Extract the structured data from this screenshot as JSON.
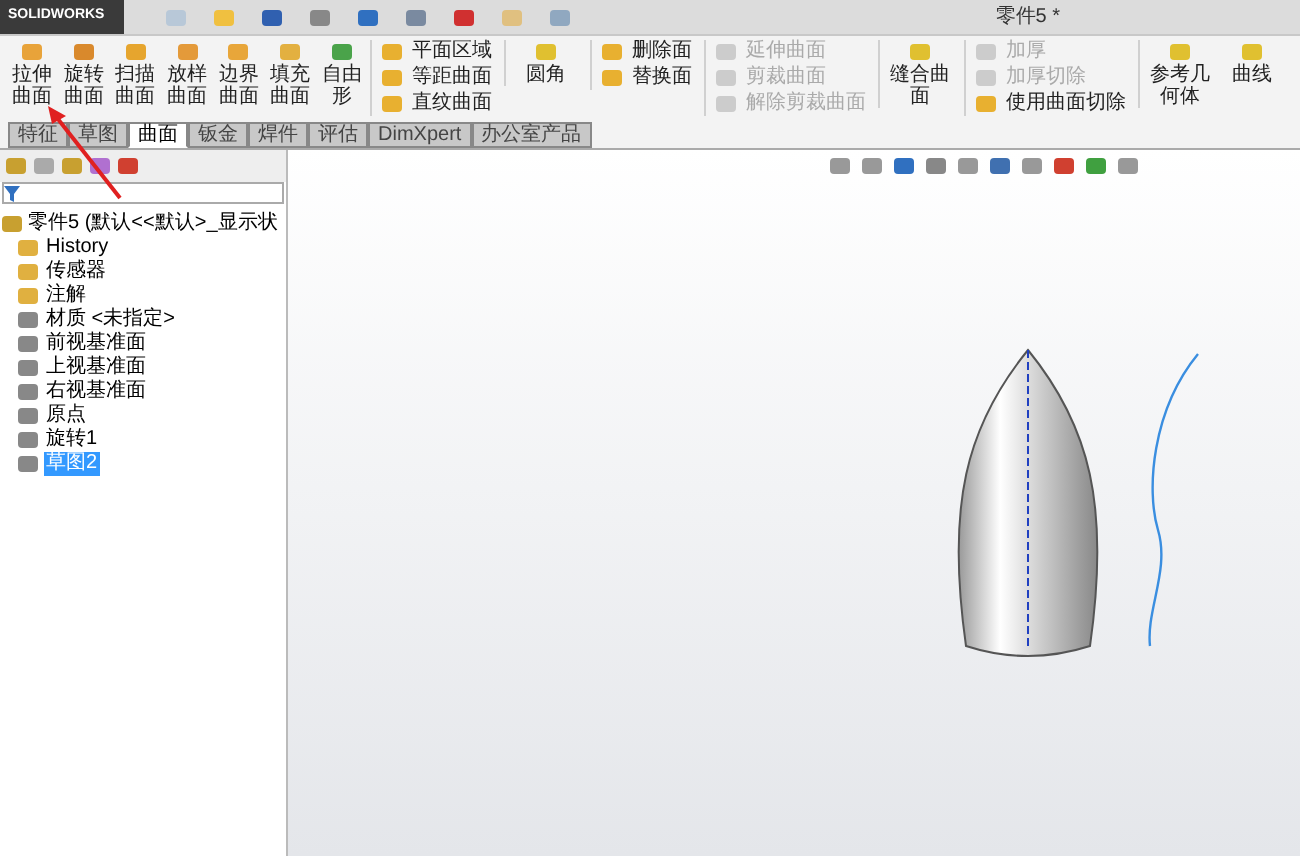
{
  "app": {
    "logo": "SOLIDWORKS",
    "title": "零件5 *"
  },
  "ribbon": {
    "big_buttons": [
      {
        "label": "拉伸曲面",
        "disabled": false
      },
      {
        "label": "旋转曲面",
        "disabled": false
      },
      {
        "label": "扫描曲面",
        "disabled": false
      },
      {
        "label": "放样曲面",
        "disabled": false
      },
      {
        "label": "边界曲面",
        "disabled": false
      },
      {
        "label": "填充曲面",
        "disabled": false
      },
      {
        "label": "自由形",
        "disabled": false
      }
    ],
    "groups": [
      {
        "kind": "column",
        "items": [
          {
            "label": "平面区域",
            "disabled": false
          },
          {
            "label": "等距曲面",
            "disabled": false
          },
          {
            "label": "直纹曲面",
            "disabled": false
          }
        ]
      },
      {
        "kind": "big",
        "items": [
          {
            "label": "圆角",
            "disabled": false
          }
        ]
      },
      {
        "kind": "column",
        "items": [
          {
            "label": "删除面",
            "disabled": false
          },
          {
            "label": "替换面",
            "disabled": false
          }
        ]
      },
      {
        "kind": "column",
        "items": [
          {
            "label": "延伸曲面",
            "disabled": true
          },
          {
            "label": "剪裁曲面",
            "disabled": true
          },
          {
            "label": "解除剪裁曲面",
            "disabled": true
          }
        ]
      },
      {
        "kind": "big",
        "items": [
          {
            "label": "缝合曲面",
            "disabled": false
          }
        ]
      },
      {
        "kind": "column",
        "items": [
          {
            "label": "加厚",
            "disabled": true
          },
          {
            "label": "加厚切除",
            "disabled": true
          },
          {
            "label": "使用曲面切除",
            "disabled": false
          }
        ]
      },
      {
        "kind": "big",
        "items": [
          {
            "label": "参考几何体",
            "disabled": false
          },
          {
            "label": "曲线",
            "disabled": false
          }
        ]
      }
    ]
  },
  "tabs": [
    {
      "label": "特征",
      "selected": false
    },
    {
      "label": "草图",
      "selected": false
    },
    {
      "label": "曲面",
      "selected": true
    },
    {
      "label": "钣金",
      "selected": false
    },
    {
      "label": "焊件",
      "selected": false
    },
    {
      "label": "评估",
      "selected": false
    },
    {
      "label": "DimXpert",
      "selected": false
    },
    {
      "label": "办公室产品",
      "selected": false
    }
  ],
  "tree": {
    "root": "零件5 (默认<<默认>_显示状",
    "items": [
      {
        "label": "History",
        "selected": false
      },
      {
        "label": "传感器",
        "selected": false
      },
      {
        "label": "注解",
        "selected": false
      },
      {
        "label": "材质 <未指定>",
        "selected": false
      },
      {
        "label": "前视基准面",
        "selected": false
      },
      {
        "label": "上视基准面",
        "selected": false
      },
      {
        "label": "右视基准面",
        "selected": false
      },
      {
        "label": "原点",
        "selected": false
      },
      {
        "label": "旋转1",
        "selected": false
      },
      {
        "label": "草图2",
        "selected": true
      }
    ]
  }
}
